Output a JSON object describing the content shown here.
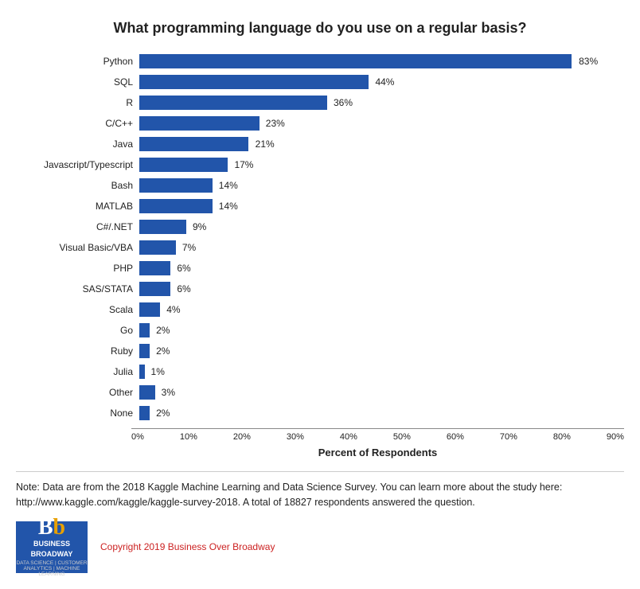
{
  "title": "What programming language do you use on a regular basis?",
  "bars": [
    {
      "label": "Python",
      "value": 83,
      "max": 90
    },
    {
      "label": "SQL",
      "value": 44,
      "max": 90
    },
    {
      "label": "R",
      "value": 36,
      "max": 90
    },
    {
      "label": "C/C++",
      "value": 23,
      "max": 90
    },
    {
      "label": "Java",
      "value": 21,
      "max": 90
    },
    {
      "label": "Javascript/Typescript",
      "value": 17,
      "max": 90
    },
    {
      "label": "Bash",
      "value": 14,
      "max": 90
    },
    {
      "label": "MATLAB",
      "value": 14,
      "max": 90
    },
    {
      "label": "C#/.NET",
      "value": 9,
      "max": 90
    },
    {
      "label": "Visual Basic/VBA",
      "value": 7,
      "max": 90
    },
    {
      "label": "PHP",
      "value": 6,
      "max": 90
    },
    {
      "label": "SAS/STATA",
      "value": 6,
      "max": 90
    },
    {
      "label": "Scala",
      "value": 4,
      "max": 90
    },
    {
      "label": "Go",
      "value": 2,
      "max": 90
    },
    {
      "label": "Ruby",
      "value": 2,
      "max": 90
    },
    {
      "label": "Julia",
      "value": 1,
      "max": 90
    },
    {
      "label": "Other",
      "value": 3,
      "max": 90
    },
    {
      "label": "None",
      "value": 2,
      "max": 90
    }
  ],
  "x_axis": {
    "labels": [
      "0%",
      "10%",
      "20%",
      "30%",
      "40%",
      "50%",
      "60%",
      "70%",
      "80%",
      "90%"
    ],
    "title": "Percent of Respondents"
  },
  "note": "Note: Data are from the 2018 Kaggle Machine Learning and Data Science Survey. You can learn more about the study here: http://www.kaggle.com/kaggle/kaggle-survey-2018.  A total of 18827 respondents answered the question.",
  "footer": {
    "logo_letters": "Bb",
    "logo_b_color": "#fff",
    "logo_b2_color": "#e8a000",
    "logo_line1": "BUSINESS",
    "logo_line2": "BROADWAY",
    "logo_tagline": "DATA SCIENCE | CUSTOMER ANALYTICS | MACHINE LEARNING",
    "copyright": "Copyright 2019 Business Over Broadway"
  }
}
